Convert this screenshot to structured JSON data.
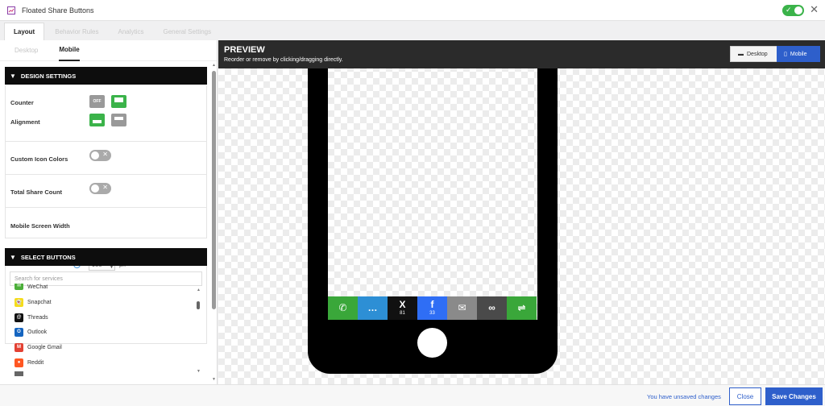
{
  "window": {
    "title": "Floated Share Buttons",
    "icon": "share-chart-icon",
    "enabled_toggle": "on",
    "close_glyph": "✕"
  },
  "main_tabs": [
    {
      "label": "Layout",
      "active": true
    },
    {
      "label": "Behavior Rules",
      "active": false
    },
    {
      "label": "Analytics",
      "active": false
    },
    {
      "label": "General Settings",
      "active": false
    }
  ],
  "sub_tabs": [
    {
      "label": "Desktop",
      "active": false
    },
    {
      "label": "Mobile",
      "active": true
    }
  ],
  "design_settings": {
    "header": "DESIGN SETTINGS",
    "counter_label": "Counter",
    "counter_off_text": "OFF",
    "alignment_label": "Alignment",
    "custom_icon_colors_label": "Custom Icon Colors",
    "total_share_count_label": "Total Share Count",
    "mobile_width_label": "Mobile Screen Width",
    "mobile_width_value": "980",
    "mobile_width_unit": "px",
    "help_glyph": "?"
  },
  "select_buttons": {
    "header": "SELECT BUTTONS",
    "search_placeholder": "Search for services",
    "services": [
      {
        "name": "WeChat",
        "color": "#4caf3a",
        "glyph": "✉"
      },
      {
        "name": "Snapchat",
        "color": "#f5dc1c",
        "glyph": "👻"
      },
      {
        "name": "Threads",
        "color": "#111111",
        "glyph": "@"
      },
      {
        "name": "Outlook",
        "color": "#1565c0",
        "glyph": "O"
      },
      {
        "name": "Google Gmail",
        "color": "#e34133",
        "glyph": "M"
      },
      {
        "name": "Reddit",
        "color": "#ff5722",
        "glyph": "●"
      }
    ]
  },
  "preview": {
    "title": "PREVIEW",
    "subtitle": "Reorder or remove by clicking/dragging directly.",
    "desktop_label": "Desktop",
    "mobile_label": "Mobile",
    "share_buttons": [
      {
        "name": "whatsapp",
        "color": "#3aa73a",
        "glyph": "✆",
        "count": ""
      },
      {
        "name": "sms",
        "color": "#2d8fd5",
        "glyph": "…",
        "count": ""
      },
      {
        "name": "x",
        "color": "#111111",
        "glyph": "X",
        "count": "81"
      },
      {
        "name": "facebook",
        "color": "#2f6ef5",
        "glyph": "f",
        "count": "33"
      },
      {
        "name": "email",
        "color": "#8a8a8a",
        "glyph": "✉",
        "count": ""
      },
      {
        "name": "copy-link",
        "color": "#4a4a4a",
        "glyph": "∞",
        "count": ""
      },
      {
        "name": "more",
        "color": "#3aa73a",
        "glyph": "⇌",
        "count": ""
      }
    ]
  },
  "footer": {
    "unsaved_text": "You have unsaved changes",
    "close_label": "Close",
    "save_label": "Save Changes"
  },
  "colors": {
    "accent": "#2e5fcb",
    "toggle_on": "#3bb34a",
    "header_dark": "#0d0d0d"
  }
}
